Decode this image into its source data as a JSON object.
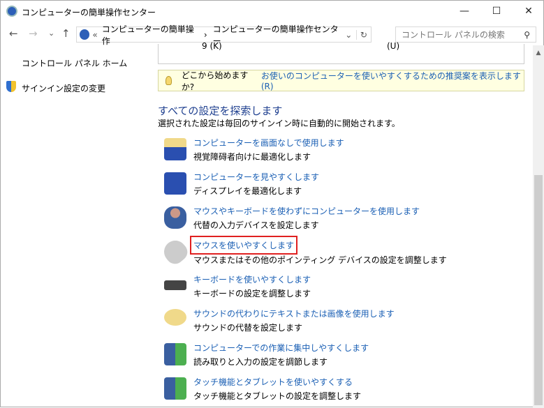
{
  "window": {
    "title": "コンピューターの簡単操作センター",
    "minimize": "—",
    "maximize": "☐",
    "close": "✕"
  },
  "nav": {
    "back": "←",
    "forward": "→",
    "recent": "⌄",
    "up": "↑"
  },
  "address": {
    "prefix": "«",
    "crumbs": [
      "コンピューターの簡単操作",
      "コンピューターの簡単操作センター"
    ],
    "sep": "›",
    "dropdown": "⌄",
    "refresh": "↻"
  },
  "search": {
    "placeholder": "コントロール パネルの検索",
    "icon": "⚲"
  },
  "sidebar": {
    "items": [
      {
        "label": "コントロール パネル ホーム"
      },
      {
        "label": "サインイン設定の変更"
      }
    ]
  },
  "top_box": {
    "left": "9 (K)",
    "right": "(U)"
  },
  "tip": {
    "question": "どこから始めますか?",
    "link": "お使いのコンピューターを使いやすくするための推奨案を表示します(R)"
  },
  "section": {
    "title": "すべての設定を探索します",
    "subtitle": "選択された設定は毎回のサインイン時に自動的に開始されます。"
  },
  "items": [
    {
      "link": "コンピューターを画面なしで使用します",
      "desc": "視覚障碍者向けに最適化します"
    },
    {
      "link": "コンピューターを見やすくします",
      "desc": "ディスプレイを最適化します"
    },
    {
      "link": "マウスやキーボードを使わずにコンピューターを使用します",
      "desc": "代替の入力デバイスを設定します"
    },
    {
      "link": "マウスを使いやすくします",
      "desc": "マウスまたはその他のポインティング デバイスの設定を調整します"
    },
    {
      "link": "キーボードを使いやすくします",
      "desc": "キーボードの設定を調整します"
    },
    {
      "link": "サウンドの代わりにテキストまたは画像を使用します",
      "desc": "サウンドの代替を設定します"
    },
    {
      "link": "コンピューターでの作業に集中しやすくします",
      "desc": "読み取りと入力の設定を調節します"
    },
    {
      "link": "タッチ機能とタブレットを使いやすくする",
      "desc": "タッチ機能とタブレットの設定を調整します"
    }
  ]
}
